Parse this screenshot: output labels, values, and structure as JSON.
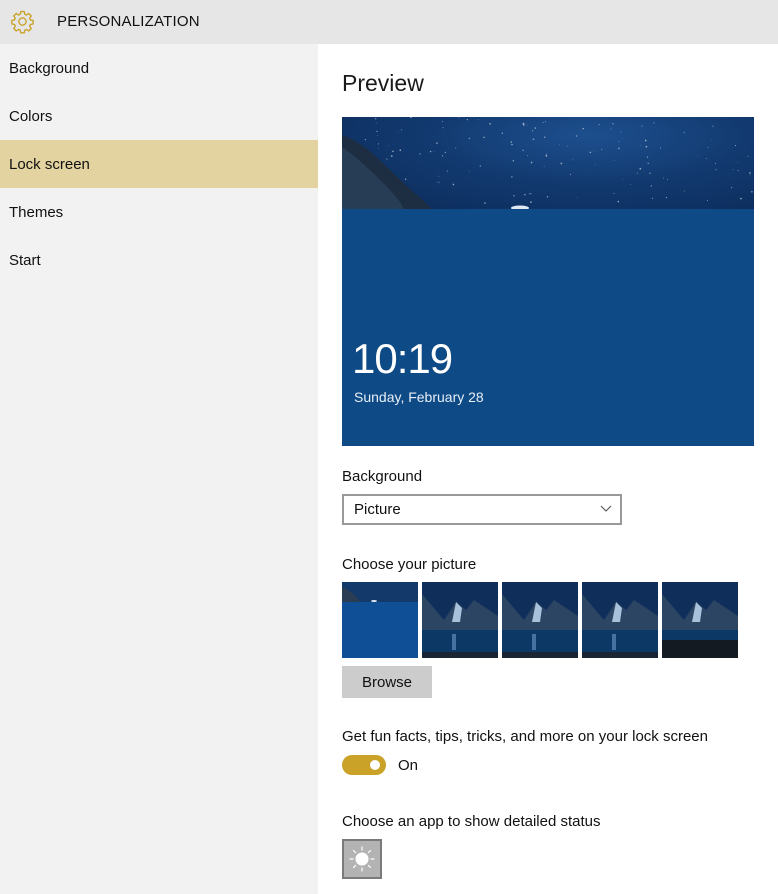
{
  "header": {
    "icon": "gear-icon",
    "title": "PERSONALIZATION",
    "accent_color": "#c9a227"
  },
  "sidebar": {
    "items": [
      {
        "label": "Background",
        "active": false
      },
      {
        "label": "Colors",
        "active": false
      },
      {
        "label": "Lock screen",
        "active": true
      },
      {
        "label": "Themes",
        "active": false
      },
      {
        "label": "Start",
        "active": false
      }
    ],
    "active_color": "#e3d3a0"
  },
  "main": {
    "preview_title": "Preview",
    "preview": {
      "time": "10:19",
      "date": "Sunday, February 28",
      "background_color": "#0e4a86"
    },
    "background": {
      "label": "Background",
      "selected": "Picture"
    },
    "choose_picture": {
      "label": "Choose your picture",
      "thumbnails": [
        {
          "name": "current-lock-screen",
          "selected": true
        },
        {
          "name": "mountain-lake-night-1"
        },
        {
          "name": "mountain-lake-night-2"
        },
        {
          "name": "mountain-lake-night-3"
        },
        {
          "name": "mountain-lake-night-4"
        }
      ],
      "browse_label": "Browse"
    },
    "fun_facts": {
      "label": "Get fun facts, tips, tricks, and more on your lock screen",
      "state_label": "On",
      "enabled": true
    },
    "detailed_status": {
      "label": "Choose an app to show detailed status",
      "app_icon": "weather-sun-icon"
    }
  }
}
